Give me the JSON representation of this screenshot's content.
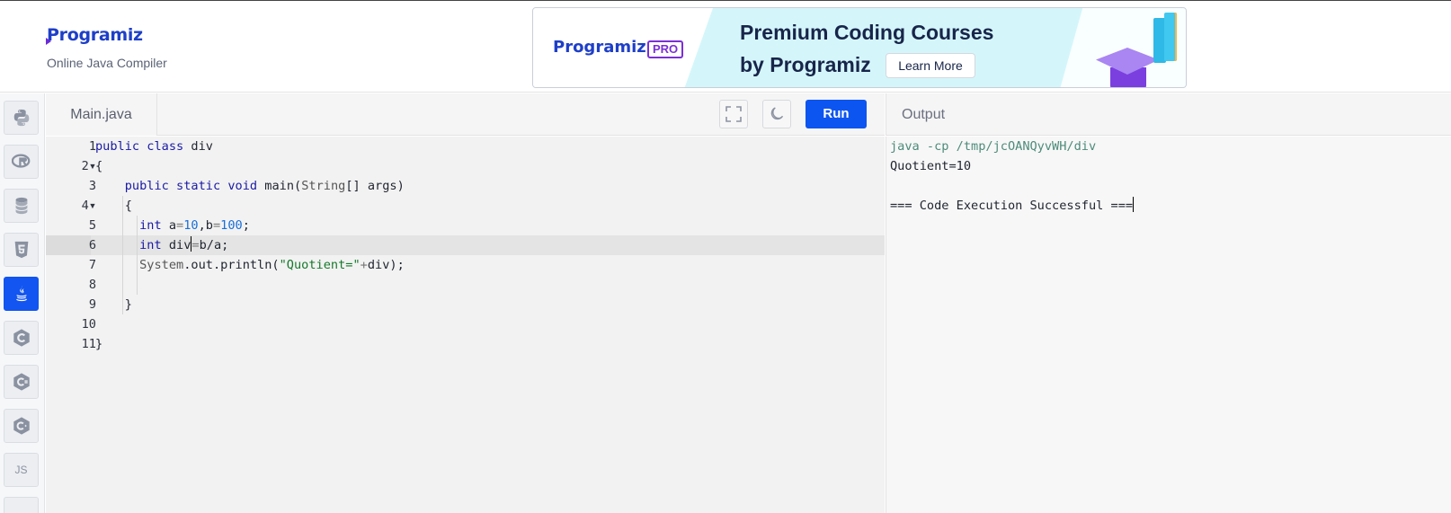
{
  "header": {
    "logo_text": "Programiz",
    "subtitle": "Online Java Compiler"
  },
  "banner": {
    "logo_text": "Programiz",
    "badge": "PRO",
    "title_line1": "Premium Coding Courses",
    "title_line2": "by Programiz",
    "cta_label": "Learn More"
  },
  "sidebar": {
    "items": [
      {
        "name": "python",
        "icon": "python-icon",
        "label": ""
      },
      {
        "name": "r",
        "icon": "r-icon",
        "label": ""
      },
      {
        "name": "sql",
        "icon": "database-icon",
        "label": ""
      },
      {
        "name": "html",
        "icon": "html5-icon",
        "label": ""
      },
      {
        "name": "java",
        "icon": "java-icon",
        "label": "",
        "active": true
      },
      {
        "name": "c",
        "icon": "c-icon",
        "label": ""
      },
      {
        "name": "csharp",
        "icon": "csharp-icon",
        "label": ""
      },
      {
        "name": "cpp",
        "icon": "cpp-icon",
        "label": ""
      },
      {
        "name": "js",
        "icon": "",
        "label": "JS"
      }
    ]
  },
  "editor": {
    "file_tab": "Main.java",
    "run_label": "Run",
    "active_line": 6,
    "lines": [
      {
        "n": "1",
        "fold": false,
        "text": "public class div"
      },
      {
        "n": "2",
        "fold": true,
        "text": "{"
      },
      {
        "n": "3",
        "fold": false,
        "text": "    public static void main(String[] args)"
      },
      {
        "n": "4",
        "fold": true,
        "text": "    {"
      },
      {
        "n": "5",
        "fold": false,
        "text": "      int a=10,b=100;"
      },
      {
        "n": "6",
        "fold": false,
        "text": "      int div=b/a;"
      },
      {
        "n": "7",
        "fold": false,
        "text": "      System.out.println(\"Quotient=\"+div);"
      },
      {
        "n": "8",
        "fold": false,
        "text": ""
      },
      {
        "n": "9",
        "fold": false,
        "text": "    }"
      },
      {
        "n": "10",
        "fold": false,
        "text": ""
      },
      {
        "n": "11",
        "fold": false,
        "text": "}"
      }
    ]
  },
  "output": {
    "title": "Output",
    "lines": [
      "java -cp /tmp/jcOANQyvWH/div",
      "Quotient=10",
      "",
      "=== Code Execution Successful ==="
    ]
  },
  "colors": {
    "accent": "#0d55f0",
    "keyword": "#1a1aa6",
    "string": "#157a2b",
    "number": "#1a6fd8"
  }
}
